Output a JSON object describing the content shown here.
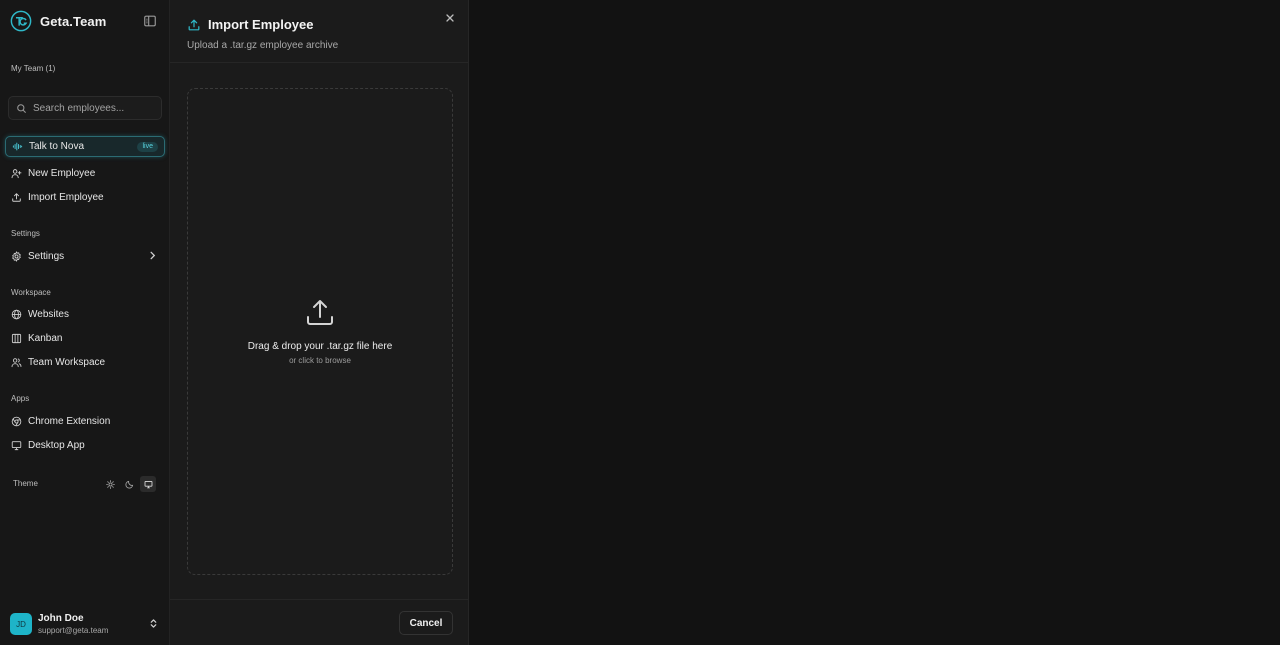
{
  "brand": {
    "name": "Geta.Team",
    "logo_icon": "geta-logo-icon",
    "accent": "#2fb8c8"
  },
  "sidebar": {
    "team_label": "My Team (1)",
    "search_placeholder": "Search employees...",
    "nova": {
      "label": "Talk to Nova",
      "badge": "live",
      "icon": "audio-waveform-icon"
    },
    "actions": [
      {
        "label": "New Employee",
        "icon": "user-plus-icon"
      },
      {
        "label": "Import Employee",
        "icon": "upload-icon"
      }
    ],
    "settings_section": {
      "label": "Settings",
      "item": {
        "label": "Settings",
        "icon": "gear-icon"
      }
    },
    "workspace_section": {
      "label": "Workspace",
      "items": [
        {
          "label": "Websites",
          "icon": "globe-icon"
        },
        {
          "label": "Kanban",
          "icon": "kanban-icon"
        },
        {
          "label": "Team Workspace",
          "icon": "users-icon"
        }
      ]
    },
    "apps_section": {
      "label": "Apps",
      "items": [
        {
          "label": "Chrome Extension",
          "icon": "chrome-icon"
        },
        {
          "label": "Desktop App",
          "icon": "monitor-icon"
        }
      ]
    },
    "theme": {
      "label": "Theme",
      "options": [
        "light",
        "dark",
        "system"
      ],
      "selected": "system"
    },
    "user": {
      "initials": "JD",
      "name": "John Doe",
      "email": "support@geta.team"
    }
  },
  "modal": {
    "title": "Import Employee",
    "subtitle": "Upload a .tar.gz employee archive",
    "dropzone": {
      "title": "Drag & drop your .tar.gz file here",
      "subtitle": "or click to browse"
    },
    "cancel_label": "Cancel"
  }
}
